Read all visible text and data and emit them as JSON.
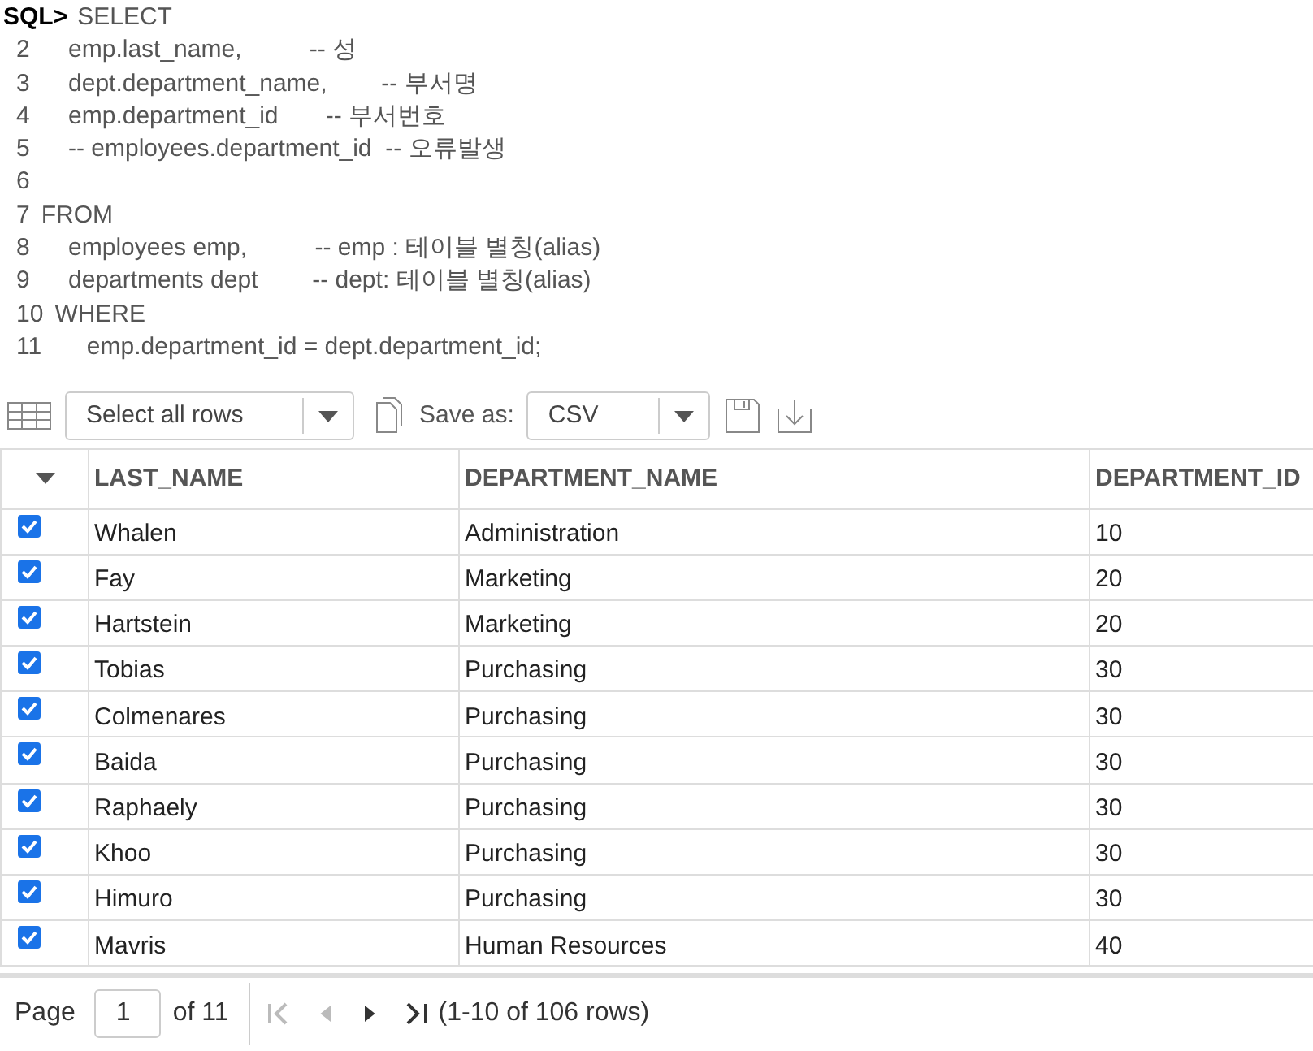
{
  "editor": {
    "prompt": "SQL>",
    "lines": [
      {
        "text": "SELECT"
      },
      {
        "number": "2",
        "text": "    emp.last_name,          -- 성"
      },
      {
        "number": "3",
        "text": "    dept.department_name,        -- 부서명"
      },
      {
        "number": "4",
        "text": "    emp.department_id       -- 부서번호"
      },
      {
        "number": "5",
        "text": "    -- employees.department_id  -- 오류발생"
      },
      {
        "number": "6"
      },
      {
        "number": "7",
        "text": "FROM"
      },
      {
        "number": "8",
        "text": "    employees emp,          -- emp : 테이블 별칭(alias)"
      },
      {
        "number": "9",
        "text": "    departments dept        -- dept: 테이블 별칭(alias)"
      },
      {
        "number": "10",
        "text": "WHERE"
      },
      {
        "number": "11",
        "text": "     emp.department_id = dept.department_id;"
      }
    ]
  },
  "toolbar": {
    "select_rows": "Select all rows",
    "save_as_label": "Save as:",
    "format": "CSV"
  },
  "table": {
    "columns": [
      "LAST_NAME",
      "DEPARTMENT_NAME",
      "DEPARTMENT_ID"
    ],
    "rows": [
      {
        "checked": true,
        "cells": [
          "Whalen",
          "Administration",
          "10"
        ]
      },
      {
        "checked": true,
        "cells": [
          "Fay",
          "Marketing",
          "20"
        ]
      },
      {
        "checked": true,
        "cells": [
          "Hartstein",
          "Marketing",
          "20"
        ]
      },
      {
        "checked": true,
        "cells": [
          "Tobias",
          "Purchasing",
          "30"
        ]
      },
      {
        "checked": true,
        "cells": [
          "Colmenares",
          "Purchasing",
          "30"
        ]
      },
      {
        "checked": true,
        "cells": [
          "Baida",
          "Purchasing",
          "30"
        ]
      },
      {
        "checked": true,
        "cells": [
          "Raphaely",
          "Purchasing",
          "30"
        ]
      },
      {
        "checked": true,
        "cells": [
          "Khoo",
          "Purchasing",
          "30"
        ]
      },
      {
        "checked": true,
        "cells": [
          "Himuro",
          "Purchasing",
          "30"
        ]
      },
      {
        "checked": true,
        "cells": [
          "Mavris",
          "Human Resources",
          "40"
        ]
      }
    ]
  },
  "pager": {
    "page_label": "Page",
    "page": "1",
    "of_pages": "of 11",
    "summary": "(1-10 of 106 rows)",
    "buttons": [
      {
        "kind": "first",
        "disabled": true
      },
      {
        "kind": "prev",
        "disabled": true
      },
      {
        "kind": "next",
        "disabled": false
      },
      {
        "kind": "last",
        "disabled": false
      }
    ]
  }
}
